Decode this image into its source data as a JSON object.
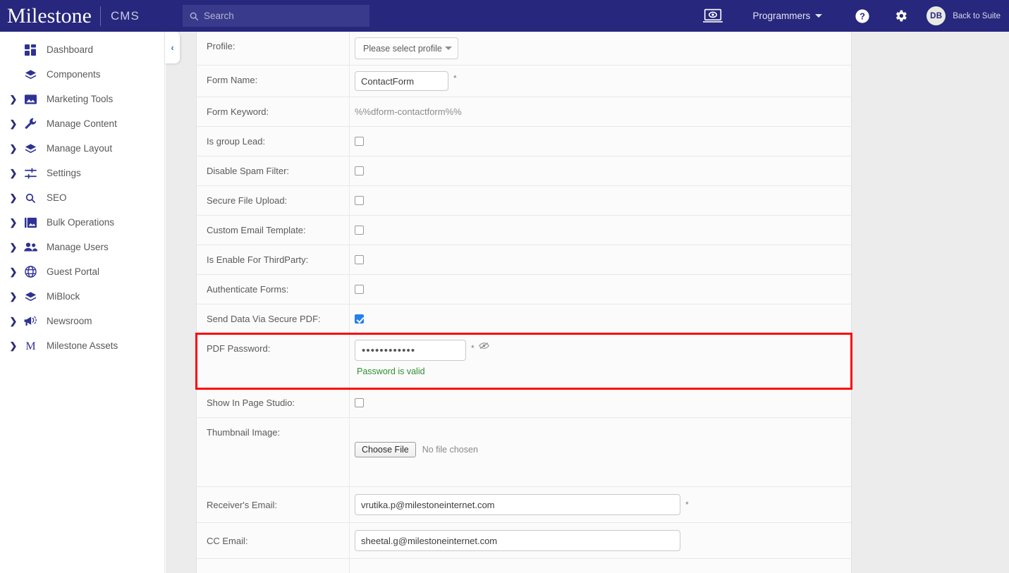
{
  "header": {
    "logo": "Milestone",
    "product": "CMS",
    "search_placeholder": "Search",
    "monitor_icon": "monitor-preview-icon",
    "user_menu": "Programmers",
    "help_icon": "help-circle-icon",
    "gear_icon": "gear-icon",
    "avatar_initials": "DB",
    "back_to_suite": "Back to Suite",
    "bg_color": "#27277d"
  },
  "sidebar": {
    "collapse_chevron": "‹",
    "items": [
      {
        "label": "Dashboard",
        "icon": "dashboard-grid-icon",
        "expandable": false
      },
      {
        "label": "Components",
        "icon": "layers-icon",
        "expandable": false
      },
      {
        "label": "Marketing Tools",
        "icon": "image-icon",
        "expandable": true
      },
      {
        "label": "Manage Content",
        "icon": "wrench-icon",
        "expandable": true
      },
      {
        "label": "Manage Layout",
        "icon": "layers-icon",
        "expandable": true
      },
      {
        "label": "Settings",
        "icon": "sliders-icon",
        "expandable": true
      },
      {
        "label": "SEO",
        "icon": "search-icon",
        "expandable": true
      },
      {
        "label": "Bulk Operations",
        "icon": "photo-library-icon",
        "expandable": true
      },
      {
        "label": "Manage Users",
        "icon": "people-icon",
        "expandable": true
      },
      {
        "label": "Guest Portal",
        "icon": "globe-icon",
        "expandable": true
      },
      {
        "label": "MiBlock",
        "icon": "layers-icon",
        "expandable": true
      },
      {
        "label": "Newsroom",
        "icon": "megaphone-icon",
        "expandable": true
      },
      {
        "label": "Milestone Assets",
        "icon": "letter-m-icon",
        "expandable": true
      }
    ]
  },
  "form": {
    "highlight_color": "#fb0a0a",
    "valid_color": "#2f8f2f",
    "rows": {
      "profile": {
        "label": "Profile:",
        "value": "Please select profile"
      },
      "form_name": {
        "label": "Form Name:",
        "value": "ContactForm",
        "required": "*"
      },
      "form_keyword": {
        "label": "Form Keyword:",
        "value": "%%dform-contactform%%"
      },
      "is_group_lead": {
        "label": "Is group Lead:",
        "checked": false
      },
      "disable_spam": {
        "label": "Disable Spam Filter:",
        "checked": false
      },
      "secure_upload": {
        "label": "Secure File Upload:",
        "checked": false
      },
      "custom_email": {
        "label": "Custom Email Template:",
        "checked": false
      },
      "third_party": {
        "label": "Is Enable For ThirdParty:",
        "checked": false
      },
      "auth_forms": {
        "label": "Authenticate Forms:",
        "checked": false
      },
      "send_pdf": {
        "label": "Send Data Via Secure PDF:",
        "checked": true
      },
      "pdf_password": {
        "label": "PDF Password:",
        "masked_value": "••••••••••••",
        "required": "*",
        "toggle_icon": "eye-slash-icon",
        "validation": "Password is valid"
      },
      "page_studio": {
        "label": "Show In Page Studio:",
        "checked": false
      },
      "thumbnail": {
        "label": "Thumbnail Image:",
        "button": "Choose File",
        "status": "No file chosen"
      },
      "receiver_email": {
        "label": "Receiver's Email:",
        "value": "vrutika.p@milestoneinternet.com",
        "required": "*"
      },
      "cc_email": {
        "label": "CC Email:",
        "value": "sheetal.g@milestoneinternet.com"
      }
    }
  }
}
